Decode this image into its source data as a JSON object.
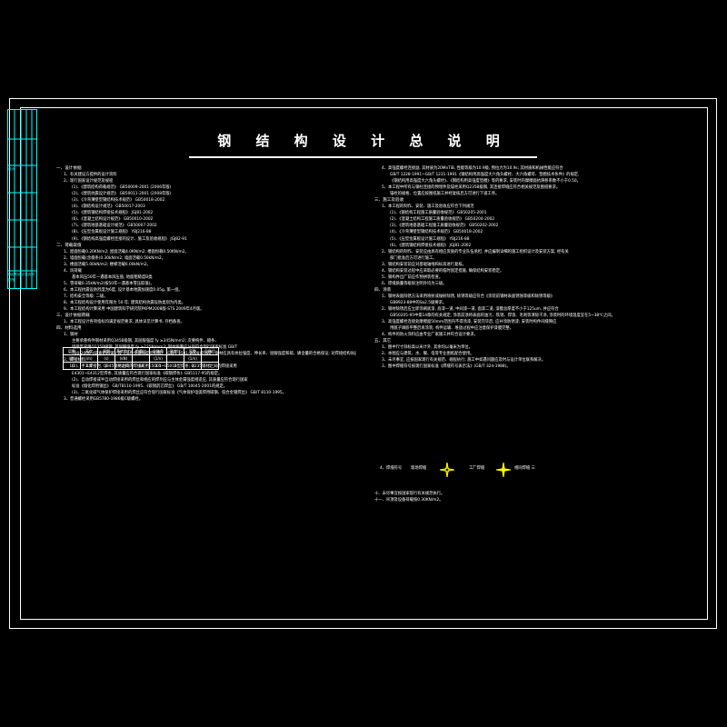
{
  "meta": {
    "background": "#000000",
    "ink": "#ffffff",
    "titleblock_color": "#00ffff",
    "symbol_color": "#ffff00"
  },
  "sheet_title": "钢 结 构 设 计 总 说 明",
  "title_block": {
    "rows": [
      {
        "label": ""
      },
      {
        "label": ""
      },
      {
        "label": "设计"
      },
      {
        "label": ""
      },
      {
        "label": ""
      },
      {
        "label": ""
      },
      {
        "label": "图号"
      }
    ],
    "footer_text": "钢结构设计总说明"
  },
  "left_column": [
    {
      "indent": 0,
      "text": "一、设计依据",
      "heading": true
    },
    {
      "indent": 1,
      "text": "1、有关建设方提供的设计资料"
    },
    {
      "indent": 1,
      "text": "2、现行国家设计规范及规程"
    },
    {
      "indent": 2,
      "text": "(1)、《建筑结构荷载规范》 GB50009-2001 (2006年版)"
    },
    {
      "indent": 2,
      "text": "(2)、《建筑抗震设计规范》 GB50011-2001 (2008年版)"
    },
    {
      "indent": 2,
      "text": "(3)、《冷弯薄壁型钢结构技术规范》 GB50018-2002"
    },
    {
      "indent": 2,
      "text": "(4)、《钢结构设计规范》 GB50017-2003"
    },
    {
      "indent": 2,
      "text": "(5)、《建筑钢结构焊接技术规程》 JGJ81-2002"
    },
    {
      "indent": 2,
      "text": "(6)、《混凝土结构设计规范》 GB50010-2002"
    },
    {
      "indent": 2,
      "text": "(7)、《建筑地基基础设计规范》 GB50007-2002"
    },
    {
      "indent": 2,
      "text": "(8)、《压型金属板设计施工规程》 YBJ216-88"
    },
    {
      "indent": 2,
      "text": "(9)、《钢结构高强度螺栓连接的设计、施工及验收规程》 JGJ82-91"
    },
    {
      "indent": 0,
      "text": "二、荷载取值",
      "heading": true
    },
    {
      "indent": 1,
      "text": "1、屋面恒载0.20KN/m2; 屋面活载4.0KN/m2; 楼面恒载0.50KN/m2。"
    },
    {
      "indent": 1,
      "text": "2、墙面恒载(含檩条)0.30kN/m2; 墙面活载0.50kN/m2。"
    },
    {
      "indent": 1,
      "text": "3、楼面活载5.00kN/m2; 楼梯活载6.00kN/m2。"
    },
    {
      "indent": 1,
      "text": "4、风荷载"
    },
    {
      "indent": 2,
      "text": "基本风压50年一遇基本风压值, 地面粗糙度B类"
    },
    {
      "indent": 0,
      "text": "",
      "heading": false
    },
    {
      "indent": 1,
      "text": "5、雪荷载0.35kN/m2(按50年一遇基本雪压取值)。"
    },
    {
      "indent": 1,
      "text": "6、本工程抗震设防烈度为6度, 设计基本地震加速度0.05g, 第一组。"
    },
    {
      "indent": 1,
      "text": "7、结构安全等级: 二级。"
    },
    {
      "indent": 1,
      "text": "8、本工程结构设计使用年限为 50 年; 建筑结构抗震设防类别为丙类。"
    },
    {
      "indent": 1,
      "text": "9、本工程结构计算采用 中国建筑科学研究院PKPM2008版-STS 2009年4月版。"
    },
    {
      "indent": 0,
      "text": "三、设计依据荷载",
      "heading": true
    },
    {
      "indent": 1,
      "text": "1、本工程设计各项指标均满足规范要求, 具体详见计算书, 存档备查。"
    },
    {
      "indent": 0,
      "text": "四、材料选用",
      "heading": true
    },
    {
      "indent": 1,
      "text": "1、钢材"
    },
    {
      "indent": 2,
      "text": "主要承重构件钢材采用Q345B级钢, 其屈服强度 fy ≥345N/mm2; 次要构件、檩条、"
    },
    {
      "indent": 2,
      "text": "墙梁等采用Q235B级钢, 其屈服强度 fy ≥235N/mm2; 钢材质量应分别符合现行国家标准 GB/T"
    },
    {
      "indent": 2,
      "text": "700-2006《碳素结构钢》及《低合金高强度结构钢》 (GB/T 1591-2008)的规定, 钢材应具有抗拉强度、伸长率、屈服强度和硫、磷含量的合格保证; 对焊接结构尚应具有碳含量的合格保证。"
    },
    {
      "indent": 1,
      "text": "2、焊接材料"
    },
    {
      "indent": 2,
      "text": "(1)、手工焊接时, Q345钢材之间的焊接采用E5003~E5016型焊条; Q235钢材之间的焊接采用"
    },
    {
      "indent": 2,
      "text": "E4301~E4312型焊条, 其质量应符合现行国家标准《碳钢焊条》GB5117-95的规定。"
    },
    {
      "indent": 2,
      "text": "(2)、自动焊接或半自动焊接采用的焊丝和相应的焊剂应与主体金属强度相适应, 其质量应符合现行国家"
    },
    {
      "indent": 2,
      "text": "标准《熔化焊用钢丝》 GB/T8110-1995、《碳钢药芯焊丝》 GB/T 10045-2001的规定。"
    },
    {
      "indent": 2,
      "text": "(3)、二氧化碳气体保护焊接采用的焊丝应符合现行国家标准《气体保护电弧焊用碳钢、低合金钢焊丝》 GB/T 8110-1995。"
    },
    {
      "indent": 1,
      "text": "3、普通螺栓采用GB5780-1986级C级螺栓。"
    }
  ],
  "right_column": [
    {
      "indent": 1,
      "text": "4、高强度螺栓连接副, 其材质为20MnTiB, 性能等级为10.9级, 预拉力为10.9s; 其材质和机械性能应符合"
    },
    {
      "indent": 2,
      "text": "GB/T 1228-1991~GB/T 1231-1991《钢结构用高强度大六角头螺栓、大六角螺母、垫圈技术条件》的规定,"
    },
    {
      "indent": 2,
      "text": "《钢结构用高强度大六角头螺栓》、《钢结构用高强度垫圈》等的要求, 安装时的摩擦面抗滑移系数不小于0.50。"
    },
    {
      "indent": 1,
      "text": "5、本工程中所有与钢柱连接的预埋件及锚栓采用Q235B级钢, 其连接焊缝应符合相关规范及图纸要求。"
    },
    {
      "indent": 2,
      "text": "锚栓的规格、位置应按图纸施工并经复核后方可进行下道工序。"
    },
    {
      "indent": 0,
      "text": "三、施工及验收",
      "heading": true
    },
    {
      "indent": 1,
      "text": "1、本工程的制作、安装、施工及验收应符合下列规范"
    },
    {
      "indent": 2,
      "text": "(1)、《钢结构工程施工质量验收规范》 GB50205-2001"
    },
    {
      "indent": 2,
      "text": "(2)、《混凝土结构工程施工质量验收规范》 GB50204-2002"
    },
    {
      "indent": 2,
      "text": "(3)、《建筑地基基础工程施工质量验收规范》 GB50202-2002"
    },
    {
      "indent": 2,
      "text": "(4)、《冷弯薄壁型钢结构技术规范》 GB50018-2002"
    },
    {
      "indent": 2,
      "text": "(5)、《压型金属板设计施工规程》 YBJ216-88"
    },
    {
      "indent": 2,
      "text": "(6)、《建筑钢结构焊接技术规程》 JGJ81-2002"
    },
    {
      "indent": 1,
      "text": "2、钢结构的制作、安装应由具有相应资质的专业队伍承担, 并应编制详细的施工组织设计及安装方案, 经有关"
    },
    {
      "indent": 2,
      "text": "部门批准后方可进行施工。"
    },
    {
      "indent": 1,
      "text": "3、钢结构安装前应对基础轴线和标高进行复核。"
    },
    {
      "indent": 1,
      "text": "4、钢结构安装过程中应采取必要的临时固定措施, 确保结构安装稳定。"
    },
    {
      "indent": 1,
      "text": "5、钢构件出厂前应作预拼装检查。"
    },
    {
      "indent": 1,
      "text": "6、焊缝质量等级除注明外均为三级。"
    },
    {
      "indent": 0,
      "text": "四、涂装",
      "heading": true
    },
    {
      "indent": 1,
      "text": "1、钢材表面除锈方法采用喷射或抛射除锈, 除锈等级应符合《涂装前钢材表面锈蚀等级和除锈等级》"
    },
    {
      "indent": 2,
      "text": "GB8923-88中的Sa2.5级要求。"
    },
    {
      "indent": 1,
      "text": "2、钢材除锈后应立即涂刷底漆, 底漆一道, 中间漆一道, 面漆二道, 漆膜总厚度不小于125um, 并应符合"
    },
    {
      "indent": 2,
      "text": "GB50205-95中第14章的有关规定, 涂装前须将表面的油污、铁锈、焊渣、毛刺等清除干净, 涂装时的环境温度宜在5~38℃之间。"
    },
    {
      "indent": 1,
      "text": "3、高强度螺栓连接处摩擦面50mm范围内不得涂漆, 安装完毕后, 应补涂防锈漆; 安装时构件间缝隙应"
    },
    {
      "indent": 2,
      "text": "用腻子填嵌平整后再涂装; 构件运输、堆放过程中应注意保护漆膜完整。"
    },
    {
      "indent": 1,
      "text": "4、构件的防火涂料应由专业厂家施工并符合设计要求。"
    },
    {
      "indent": 0,
      "text": "五、其它",
      "heading": true
    },
    {
      "indent": 1,
      "text": "1、图中尺寸除标高以米计外, 其余均以毫米为单位。"
    },
    {
      "indent": 1,
      "text": "2、本图应与建筑、水、暖、电等专业图纸配合使用。"
    },
    {
      "indent": 1,
      "text": "3、未尽事宜, 应按国家现行有关规范、规程执行; 施工中如遇问题应及时与设计单位联系解决。"
    },
    {
      "indent": 1,
      "text": "3、图中焊缝符号按现行国家标准《焊缝符号表示法》(GB/T 324-1988)。"
    }
  ],
  "parameter_table": {
    "caption": "2)10年一遇基本风压值, 地面粗糙度B类",
    "header_row1": [
      "层数",
      "高度",
      "周期",
      "基底剪力",
      "剪重比",
      "位移角",
      "刚度比",
      "层数",
      "位移比"
    ],
    "header_row2": [
      "(层)",
      "(m)",
      "(s)",
      "(kN)",
      "",
      "(1/n)",
      "",
      "(1/n)",
      ""
    ],
    "values": [
      "10",
      "8.8",
      "0",
      "7.495",
      "44",
      "3.5",
      "2",
      "3",
      "1"
    ]
  },
  "legend": {
    "label": "4、焊缝符号",
    "items": [
      {
        "name": "现场焊缝",
        "symbol": "field-weld",
        "color": "#ffff00",
        "filled": false
      },
      {
        "name": "工厂焊缝",
        "symbol": "shop-weld",
        "color": "#ffff00",
        "filled": true
      }
    ],
    "after_label": "相同焊缝 三"
  },
  "footer_notes": [
    "十、未尽事宜按国家现行有关规范执行。",
    "十一、吊顶及设备荷载按0.30KN/m2。"
  ]
}
